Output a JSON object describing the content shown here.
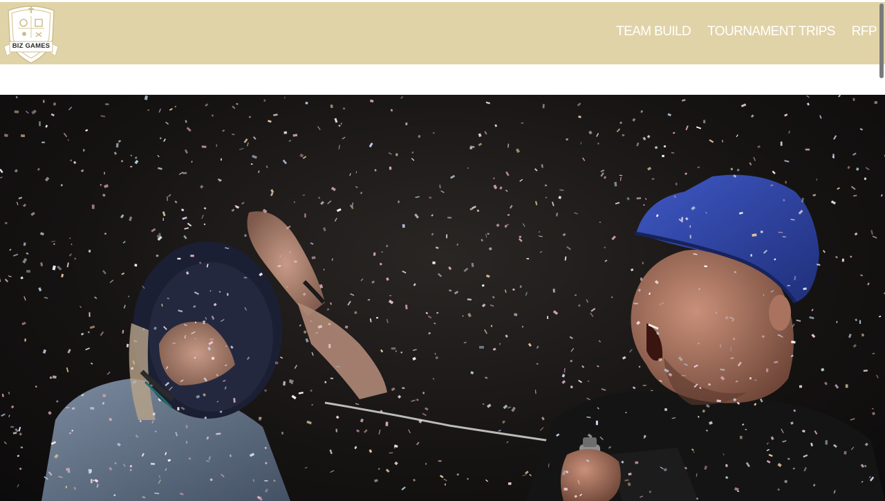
{
  "header": {
    "background_color": "#e1d3a8",
    "logo": {
      "text": "BIZ GAMES",
      "icon": "crest-shield-icon"
    },
    "nav": [
      {
        "label": "TEAM BUILD"
      },
      {
        "label": "TOURNAMENT TRIPS"
      },
      {
        "label": "RFP"
      }
    ],
    "nav_text_color": "#ffffff"
  },
  "hero": {
    "image": "confetti-celebration-photo"
  }
}
